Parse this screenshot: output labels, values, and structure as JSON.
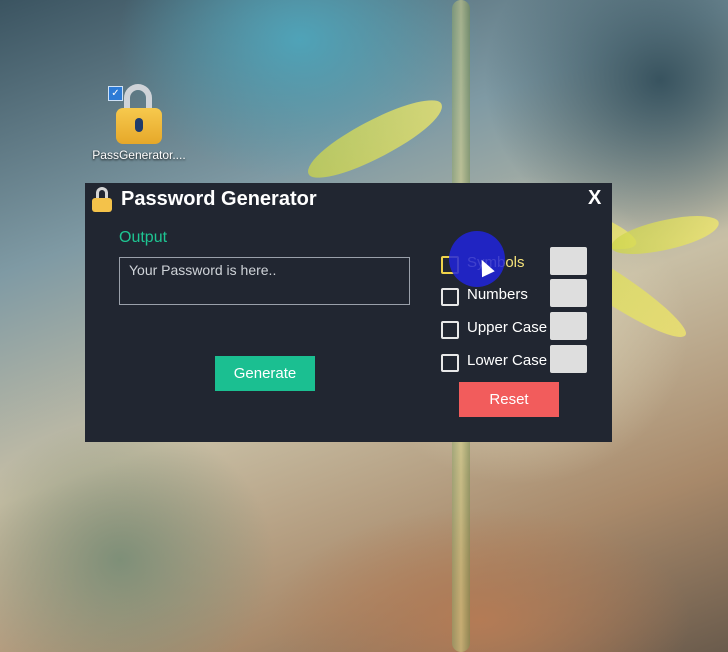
{
  "desktop": {
    "icon_label": "PassGenerator...."
  },
  "window": {
    "title": "Password Generator",
    "close_label": "X"
  },
  "output": {
    "label": "Output",
    "placeholder": "Your Password is here.."
  },
  "buttons": {
    "generate": "Generate",
    "reset": "Reset"
  },
  "options": [
    {
      "label": "Symbols",
      "checked": false
    },
    {
      "label": "Numbers",
      "checked": false
    },
    {
      "label": "Upper Case",
      "checked": false
    },
    {
      "label": "Lower Case",
      "checked": false
    }
  ],
  "colors": {
    "window_bg": "#212631",
    "accent_green": "#1bbf91",
    "reset_red": "#f25c5c",
    "cursor_highlight": "#2024dc"
  }
}
